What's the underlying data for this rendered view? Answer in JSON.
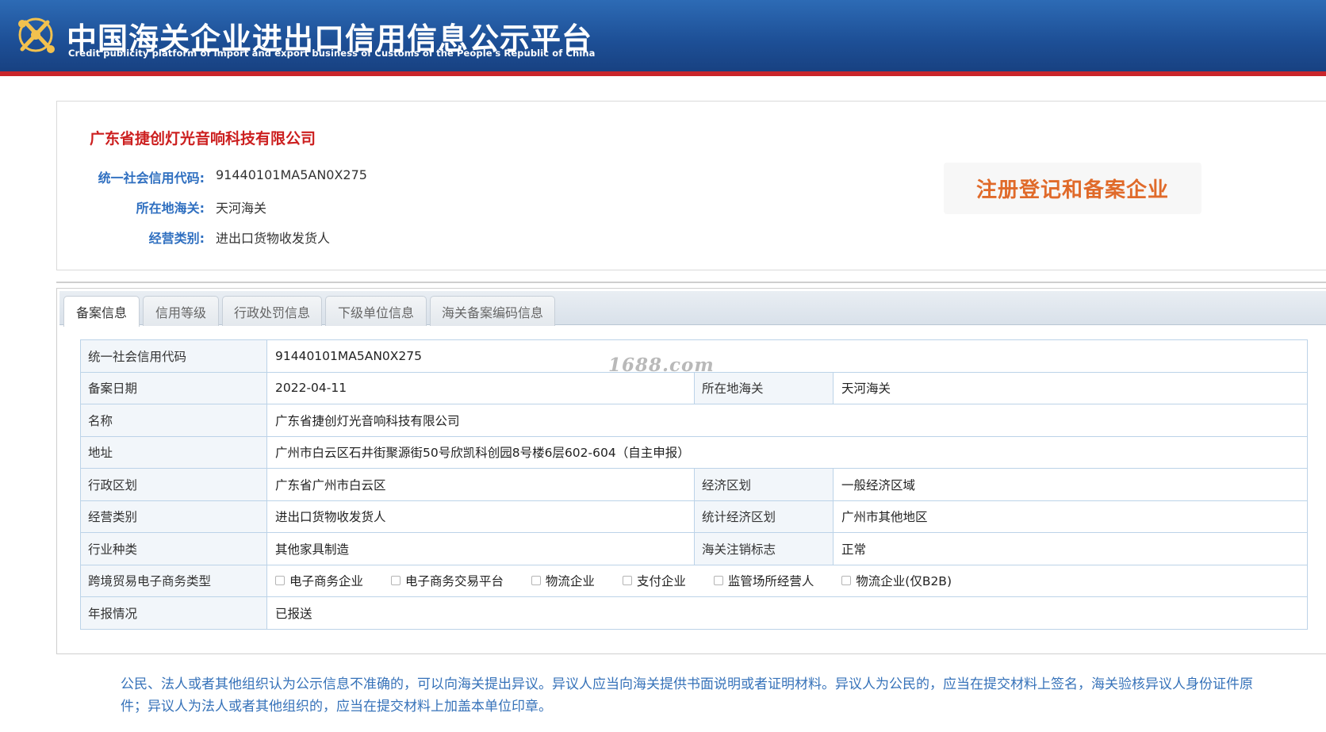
{
  "header": {
    "title": "中国海关企业进出口信用信息公示平台",
    "subtitle": "Credit publicity platform of import and export business of Customs of the People's Republic of China",
    "logo_icon": "customs-emblem-icon"
  },
  "company": {
    "name": "广东省捷创灯光音响科技有限公司",
    "fields": [
      {
        "label": "统一社会信用代码:",
        "value": "91440101MA5AN0X275"
      },
      {
        "label": "所在地海关:",
        "value": "天河海关"
      },
      {
        "label": "经营类别:",
        "value": "进出口货物收发货人"
      }
    ],
    "stamp": "注册登记和备案企业"
  },
  "tabs": [
    {
      "label": "备案信息",
      "active": true
    },
    {
      "label": "信用等级",
      "active": false
    },
    {
      "label": "行政处罚信息",
      "active": false
    },
    {
      "label": "下级单位信息",
      "active": false
    },
    {
      "label": "海关备案编码信息",
      "active": false
    }
  ],
  "table": {
    "credit_code_label": "统一社会信用代码",
    "credit_code_value": "91440101MA5AN0X275",
    "reg_date_label": "备案日期",
    "reg_date_value": "2022-04-11",
    "customs_label": "所在地海关",
    "customs_value": "天河海关",
    "name_label": "名称",
    "name_value": "广东省捷创灯光音响科技有限公司",
    "address_label": "地址",
    "address_value": "广州市白云区石井街聚源街50号欣凯科创园8号楼6层602-604（自主申报）",
    "admin_region_label": "行政区划",
    "admin_region_value": "广东省广州市白云区",
    "econ_region_label": "经济区划",
    "econ_region_value": "一般经济区域",
    "business_type_label": "经营类别",
    "business_type_value": "进出口货物收发货人",
    "stat_region_label": "统计经济区划",
    "stat_region_value": "广州市其他地区",
    "industry_label": "行业种类",
    "industry_value": "其他家具制造",
    "cancel_label": "海关注销标志",
    "cancel_value": "正常",
    "ecommerce_label": "跨境贸易电子商务类型",
    "ecommerce_options": [
      "电子商务企业",
      "电子商务交易平台",
      "物流企业",
      "支付企业",
      "监管场所经营人",
      "物流企业(仅B2B)"
    ],
    "annual_label": "年报情况",
    "annual_value": "已报送"
  },
  "watermark": "1688.com",
  "notice": "公民、法人或者其他组织认为公示信息不准确的，可以向海关提出异议。异议人应当向海关提供书面说明或者证明材料。异议人为公民的，应当在提交材料上签名，海关验核异议人身份证件原件；异议人为法人或者其他组织的，应当在提交材料上加盖本单位印章。"
}
